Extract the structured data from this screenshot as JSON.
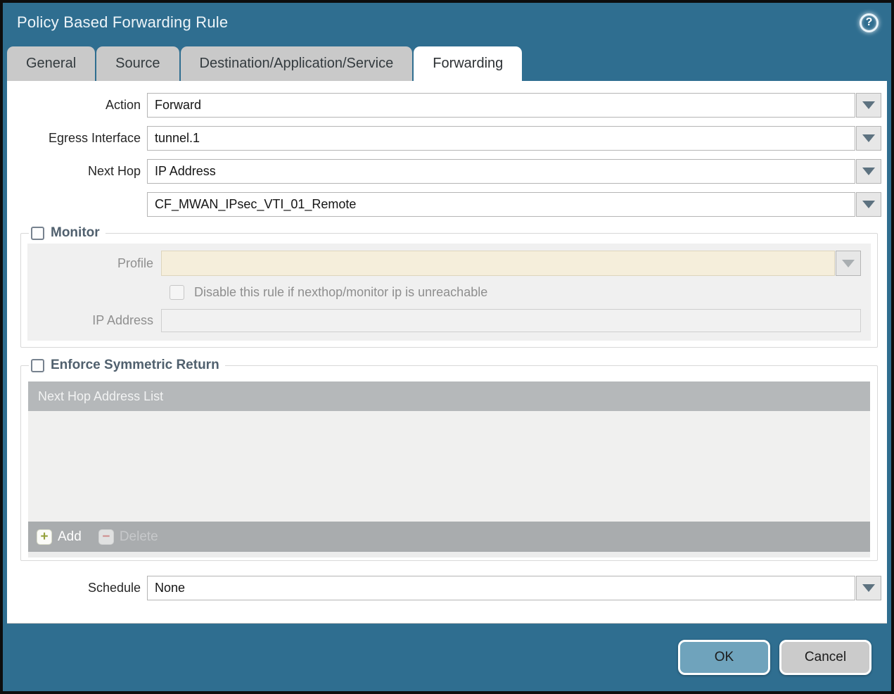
{
  "dialog": {
    "title": "Policy Based Forwarding Rule"
  },
  "help": {
    "glyph": "?"
  },
  "tabs": [
    {
      "label": "General",
      "active": false
    },
    {
      "label": "Source",
      "active": false
    },
    {
      "label": "Destination/Application/Service",
      "active": false
    },
    {
      "label": "Forwarding",
      "active": true
    }
  ],
  "form": {
    "action": {
      "label": "Action",
      "value": "Forward"
    },
    "egress_interface": {
      "label": "Egress Interface",
      "value": "tunnel.1"
    },
    "next_hop": {
      "label": "Next Hop",
      "value": "IP Address"
    },
    "next_hop_address": {
      "value": "CF_MWAN_IPsec_VTI_01_Remote"
    },
    "schedule": {
      "label": "Schedule",
      "value": "None"
    }
  },
  "monitor": {
    "title": "Monitor",
    "checked": false,
    "profile": {
      "label": "Profile",
      "value": ""
    },
    "disable_rule": {
      "label": "Disable this rule if nexthop/monitor ip is unreachable",
      "checked": false
    },
    "ip_address": {
      "label": "IP Address",
      "value": ""
    }
  },
  "symmetric_return": {
    "title": "Enforce Symmetric Return",
    "checked": false,
    "table": {
      "header": "Next Hop Address List",
      "rows": []
    },
    "add_label": "Add",
    "delete_label": "Delete",
    "add_glyph": "+",
    "delete_glyph": "−"
  },
  "footer": {
    "ok_label": "OK",
    "cancel_label": "Cancel"
  },
  "colors": {
    "titlebar_teal": "#2F6E90",
    "tab_inactive": "#C9C9C9",
    "section_title": "#50606E",
    "disabled_field_cream": "#F5EEDB",
    "table_header_gray": "#B5B8BA",
    "table_footer_gray": "#A9ACAE",
    "ok_button": "#6FA3BC",
    "cancel_button": "#CBCBCB"
  }
}
